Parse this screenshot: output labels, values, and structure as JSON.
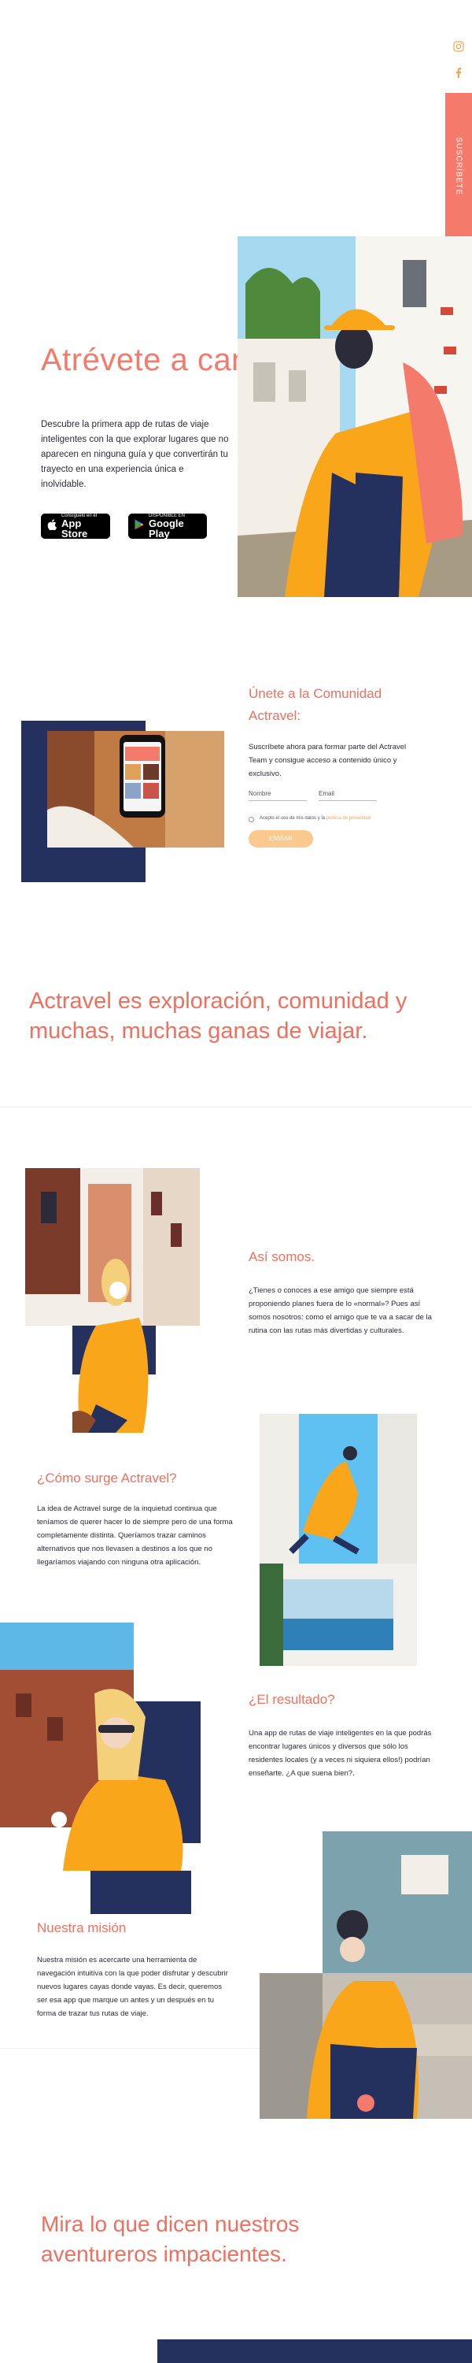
{
  "sidebar": {
    "subscribe_label": "SUSCRÍBETE",
    "icons": [
      "instagram-icon",
      "facebook-icon"
    ]
  },
  "hero": {
    "title": "Atrévete a cantar",
    "description": "Descubre la primera app de rutas de viaje inteligentes con la que explorar lugares que no aparecen en ninguna guía y que convertirán tu trayecto en una experiencia única e inolvidable.",
    "app_store_small": "Consíguelo en el",
    "app_store_big": "App Store",
    "google_play_small": "DISPONIBLE EN",
    "google_play_big": "Google Play"
  },
  "community": {
    "title": "Únete a la Comunidad Actravel:",
    "description": "Suscríbete ahora para formar parte del Actravel Team y consigue acceso a contenido único y exclusivo.",
    "name_placeholder": "Nombre",
    "email_placeholder": "Email",
    "accept_text": "Acepto el uso de mis datos y la",
    "accept_link": "política de privacidad",
    "submit_label": "ENVIAR"
  },
  "statement": "Actravel es exploración, comunidad y muchas, muchas ganas de viajar.",
  "about": {
    "title": "Así somos.",
    "body": "¿Tienes o conoces a ese amigo que siempre está proponiendo planes fuera de lo «normal»? Pues así somos nosotros: como el amigo que te va a sacar de la rutina con las rutas más divertidas y culturales."
  },
  "origin": {
    "title": "¿Cómo surge Actravel?",
    "body": "La idea de Actravel surge de la inquietud continua que teníamos de querer hacer lo de siempre pero de una forma completamente distinta. Queríamos trazar caminos alternativos que nos llevasen a destinos a los que no llegaríamos viajando con ninguna otra aplicación."
  },
  "result": {
    "title": "¿El resultado?",
    "body": "Una app de rutas de viaje inteligentes en la que podrás encontrar lugares únicos y diversos que sólo los residentes locales (y a veces ni siquiera ellos!) podrían enseñarte. ¿A que suena bien?."
  },
  "mission": {
    "title": "Nuestra misión",
    "body": "Nuestra misión es acercarte una herramienta de navegación intuitiva con la que poder disfrutar y descubrir nuevos lugares cayas donde vayas. Es decir, queremos ser esa app que marque un antes y un después en tu forma de trazar tus rutas de viaje."
  },
  "testimonials_title": "Mira lo que dicen nuestros aventureros impacientes.",
  "colors": {
    "coral": "#f06f5f",
    "navy": "#24315f",
    "orange": "#f9a61a",
    "peach": "#fbc98d"
  }
}
